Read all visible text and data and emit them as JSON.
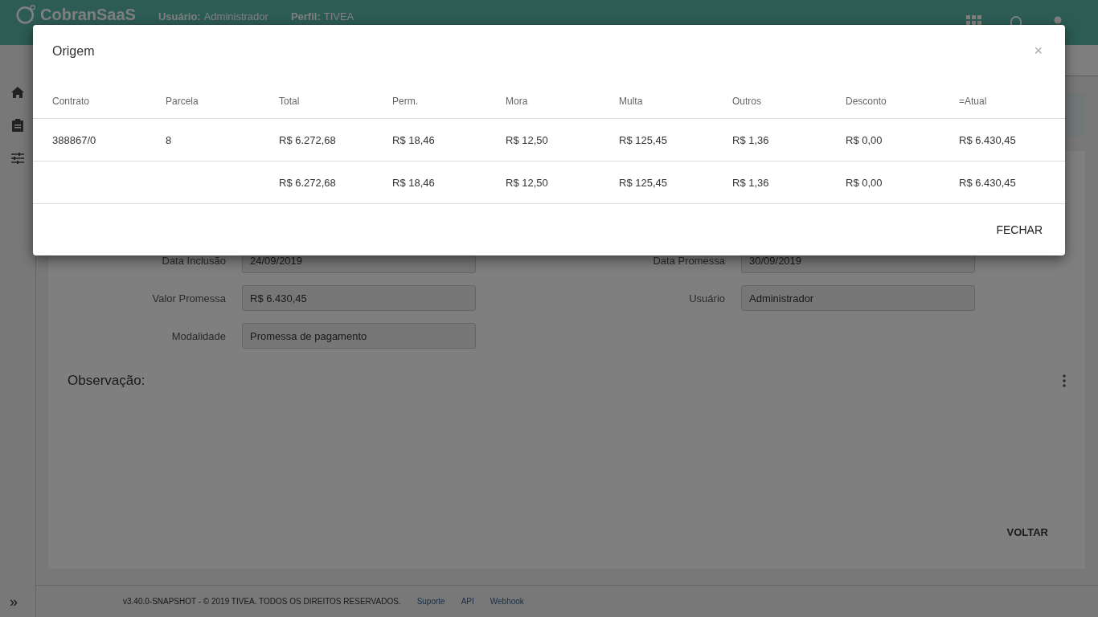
{
  "header": {
    "logo": "CobranSaaS",
    "user_label": "Usuário:",
    "user": "Administrador",
    "profile_label": "Perfil:",
    "profile": "TIVEA"
  },
  "form": {
    "left": [
      {
        "label": "Data Inclusão",
        "value": "24/09/2019"
      },
      {
        "label": "Valor Promessa",
        "value": "R$ 6.430,45"
      },
      {
        "label": "Modalidade",
        "value": "Promessa de pagamento"
      }
    ],
    "right": [
      {
        "label": "Data Promessa",
        "value": "30/09/2019"
      },
      {
        "label": "Usuário",
        "value": "Administrador"
      }
    ]
  },
  "observation": {
    "title": "Observação:"
  },
  "back_button": "VOLTAR",
  "footer": {
    "copyright": "v3.40.0-SNAPSHOT - © 2019 TIVEA. TODOS OS DIREITOS RESERVADOS.",
    "links": [
      "Suporte",
      "API",
      "Webhook"
    ],
    "expand": "»"
  },
  "dialog": {
    "title": "Origem",
    "close": "×",
    "columns": [
      "Contrato",
      "Parcela",
      "Total",
      "Perm.",
      "Mora",
      "Multa",
      "Outros",
      "Desconto",
      "=Atual"
    ],
    "rows": [
      [
        "388867/0",
        "8",
        "R$ 6.272,68",
        "R$ 18,46",
        "R$ 12,50",
        "R$ 125,45",
        "R$ 1,36",
        "R$ 0,00",
        "R$ 6.430,45"
      ],
      [
        "",
        "",
        "R$ 6.272,68",
        "R$ 18,46",
        "R$ 12,50",
        "R$ 125,45",
        "R$ 1,36",
        "R$ 0,00",
        "R$ 6.430,45"
      ]
    ],
    "button": "FECHAR"
  }
}
